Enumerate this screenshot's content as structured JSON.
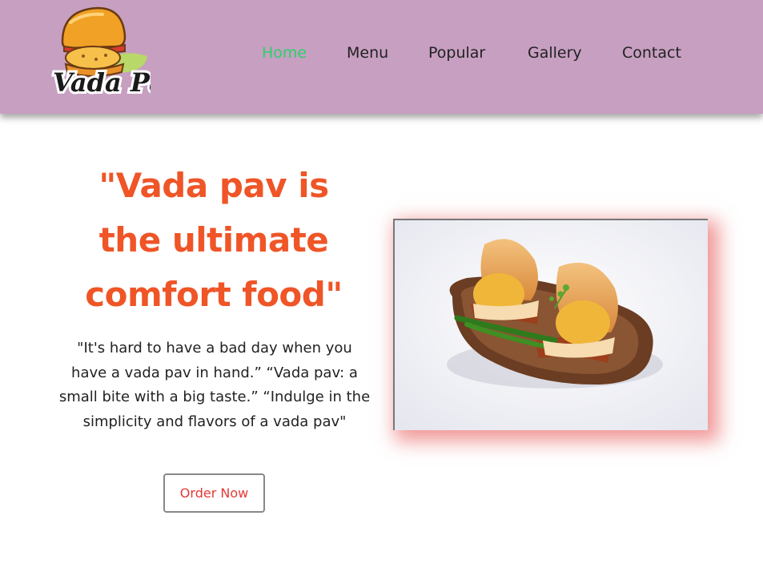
{
  "brand": {
    "logo_text": "Vada Pav",
    "logo_icon": "burger-bun-icon"
  },
  "nav": {
    "items": [
      {
        "label": "Home",
        "active": true
      },
      {
        "label": "Menu",
        "active": false
      },
      {
        "label": "Popular",
        "active": false
      },
      {
        "label": "Gallery",
        "active": false
      },
      {
        "label": "Contact",
        "active": false
      }
    ]
  },
  "hero": {
    "headline_line1": "\"Vada pav is",
    "headline_line2": "the ultimate",
    "headline_line3": "comfort food\"",
    "quote": "\"It's hard to have a bad day when you have a vada pav in hand.” “Vada pav: a small bite with a big taste.” “Indulge in the simplicity and flavors of a vada pav\"",
    "cta_label": "Order Now",
    "image_subject": "vada-pav-plate-image"
  },
  "colors": {
    "header_bg": "#c79fc1",
    "nav_active": "#2bd16a",
    "nav_text": "#222222",
    "headline": "#ef5527",
    "cta_text": "#e53935",
    "image_shadow": "#e64646"
  }
}
